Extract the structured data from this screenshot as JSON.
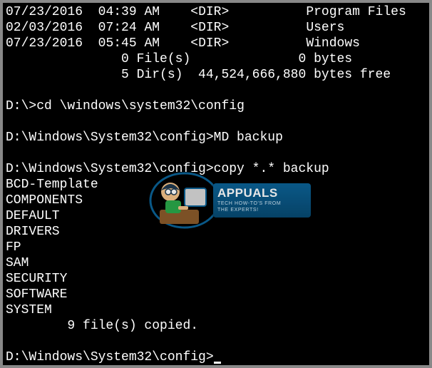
{
  "dir_listing": [
    {
      "date": "07/23/2016",
      "time": "04:39 AM",
      "type": "<DIR>",
      "name": "Program Files"
    },
    {
      "date": "02/03/2016",
      "time": "07:24 AM",
      "type": "<DIR>",
      "name": "Users"
    },
    {
      "date": "07/23/2016",
      "time": "05:45 AM",
      "type": "<DIR>",
      "name": "Windows"
    }
  ],
  "summary_files": "               0 File(s)              0 bytes",
  "summary_dirs": "               5 Dir(s)  44,524,666,880 bytes free",
  "prompt1": "D:\\>",
  "cmd1": "cd \\windows\\system32\\config",
  "prompt2": "D:\\Windows\\System32\\config>",
  "cmd2": "MD backup",
  "prompt3": "D:\\Windows\\System32\\config>",
  "cmd3": "copy *.* backup",
  "copied_files": [
    "BCD-Template",
    "COMPONENTS",
    "DEFAULT",
    "DRIVERS",
    "FP",
    "SAM",
    "SECURITY",
    "SOFTWARE",
    "SYSTEM"
  ],
  "copied_summary": "        9 file(s) copied.",
  "prompt4": "D:\\Windows\\System32\\config>",
  "watermark": {
    "title": "APPUALS",
    "subtitle1": "TECH HOW-TO'S FROM",
    "subtitle2": "THE EXPERTS!"
  }
}
